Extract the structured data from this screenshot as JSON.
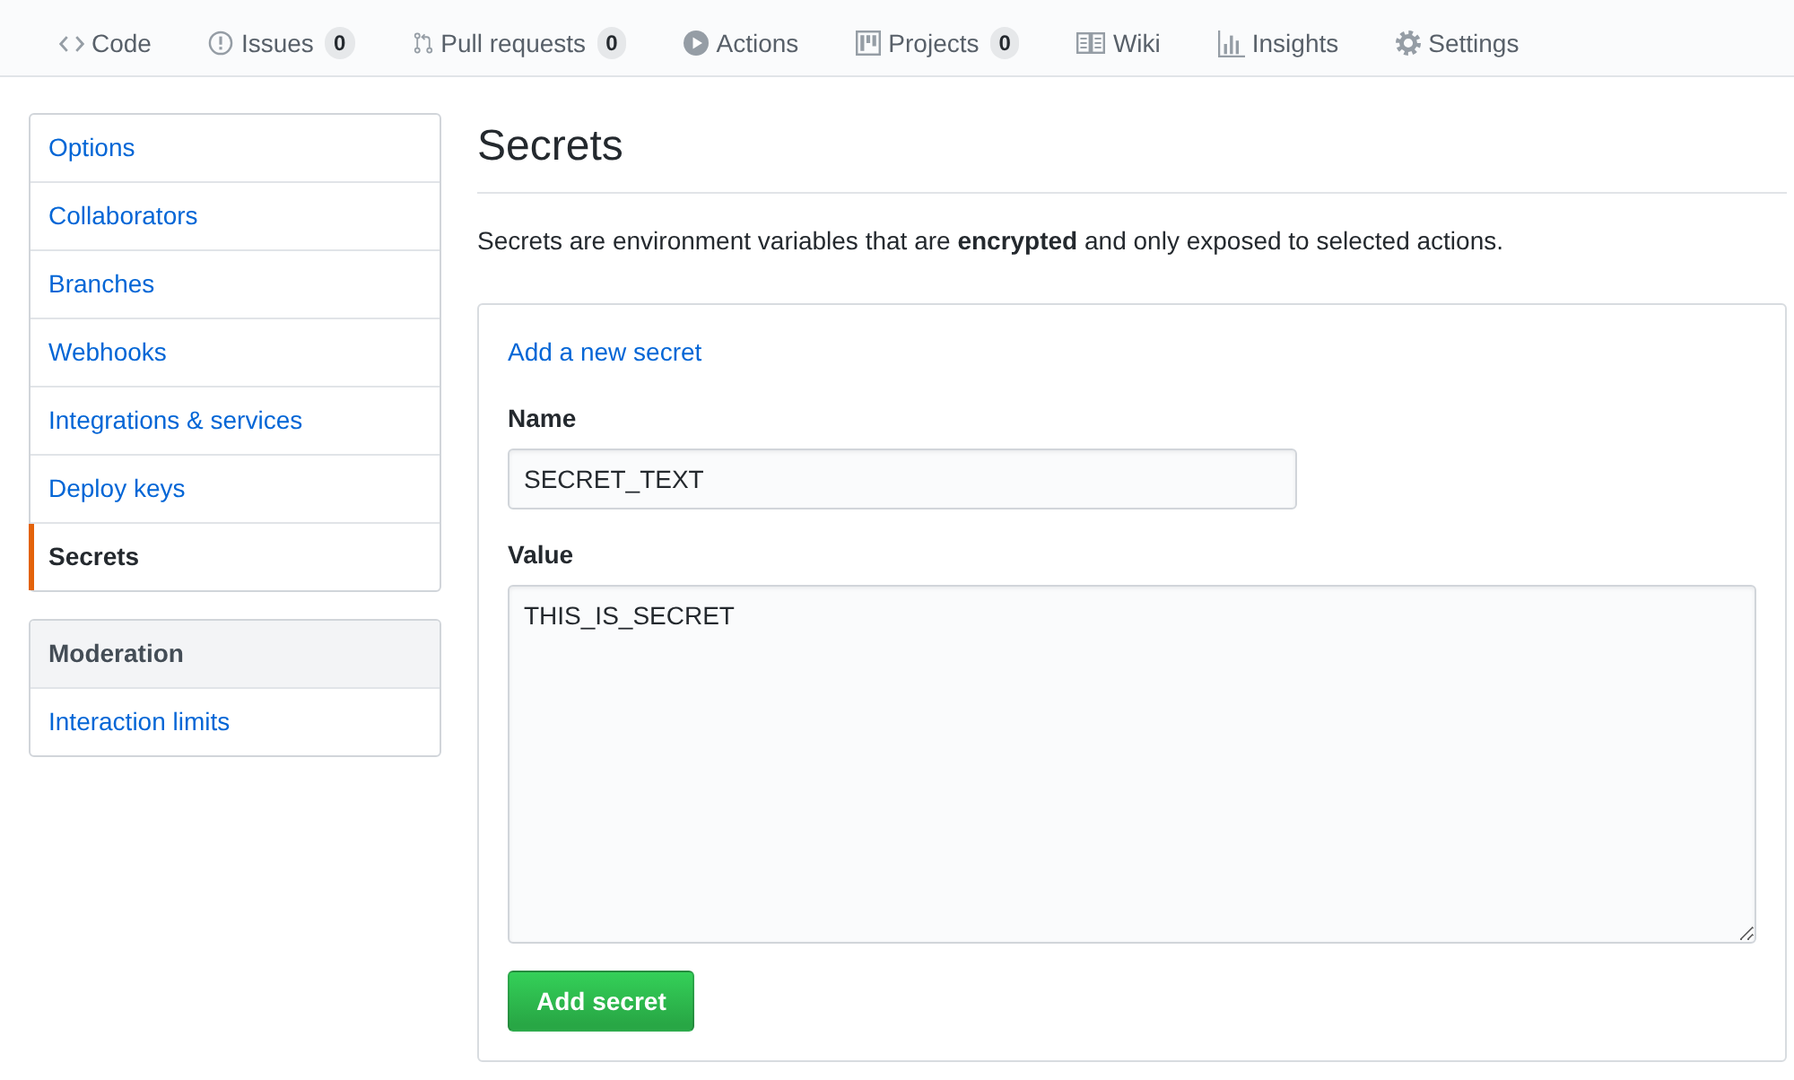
{
  "tabs": [
    {
      "kind": "code",
      "label": "Code"
    },
    {
      "kind": "issues",
      "label": "Issues",
      "count": "0"
    },
    {
      "kind": "pulls",
      "label": "Pull requests",
      "count": "0"
    },
    {
      "kind": "actions",
      "label": "Actions"
    },
    {
      "kind": "projects",
      "label": "Projects",
      "count": "0"
    },
    {
      "kind": "wiki",
      "label": "Wiki"
    },
    {
      "kind": "insights",
      "label": "Insights"
    },
    {
      "kind": "settings",
      "label": "Settings"
    }
  ],
  "sidebar": {
    "groups": [
      {
        "items": [
          {
            "label": "Options",
            "selected": false
          },
          {
            "label": "Collaborators",
            "selected": false
          },
          {
            "label": "Branches",
            "selected": false
          },
          {
            "label": "Webhooks",
            "selected": false
          },
          {
            "label": "Integrations & services",
            "selected": false
          },
          {
            "label": "Deploy keys",
            "selected": false
          },
          {
            "label": "Secrets",
            "selected": true
          }
        ]
      },
      {
        "heading": "Moderation",
        "items": [
          {
            "label": "Interaction limits",
            "selected": false
          }
        ]
      }
    ]
  },
  "main": {
    "title": "Secrets",
    "description": "Secrets are environment variables that are **encrypted** and only exposed to selected actions.",
    "form": {
      "link": "Add a new secret",
      "fields": [
        {
          "kind": "input",
          "label": "Name",
          "value": "SECRET_TEXT"
        },
        {
          "kind": "textarea",
          "label": "Value",
          "value": "THIS_IS_SECRET"
        }
      ],
      "submit": "Add secret"
    }
  }
}
